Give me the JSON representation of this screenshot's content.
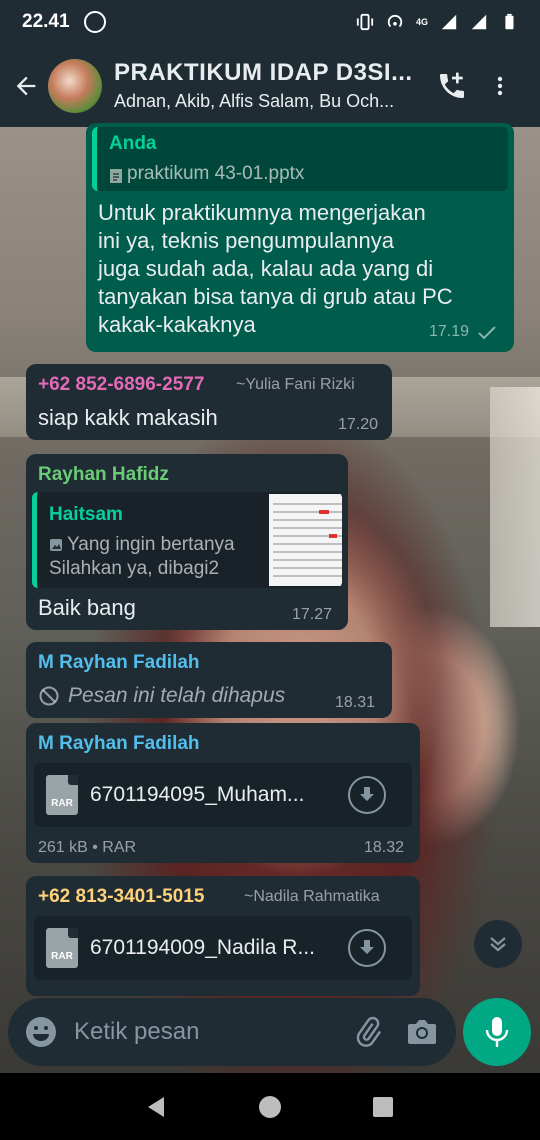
{
  "status_bar": {
    "time": "22.41",
    "network": "4G"
  },
  "header": {
    "group_name": "PRAKTIKUM IDAP D3SI...",
    "members": "Adnan, Akib, Alfis Salam, Bu Och..."
  },
  "messages": {
    "m1": {
      "quote_author": "Anda",
      "quote_file": "praktikum 43-01.pptx",
      "text_lines": [
        "Untuk praktikumnya mengerjakan",
        "ini ya, teknis pengumpulannya",
        "juga sudah ada, kalau ada yang di",
        "tanyakan bisa tanya di grub atau PC",
        "kakak-kakaknya"
      ],
      "time": "17.19"
    },
    "m2": {
      "sender": "+62 852-6896-2577",
      "pushname": "~Yulia Fani Rizki",
      "text": "siap kakk makasih",
      "time": "17.20"
    },
    "m3": {
      "sender": "Rayhan Hafidz",
      "quote_author": "Haitsam",
      "quote_line1": "Yang ingin bertanya",
      "quote_line2": "Silahkan ya, dibagi2",
      "text": "Baik bang",
      "time": "17.27"
    },
    "m4": {
      "sender": "M Rayhan Fadilah",
      "text": "Pesan ini telah dihapus",
      "time": "18.31"
    },
    "m5": {
      "sender": "M Rayhan Fadilah",
      "file_name": "6701194095_Muham...",
      "file_type": "RAR",
      "file_info": "261 kB • RAR",
      "time": "18.32"
    },
    "m6": {
      "sender": "+62 813-3401-5015",
      "pushname": "~Nadila Rahmatika",
      "file_name": "6701194009_Nadila R...",
      "file_type": "RAR"
    }
  },
  "compose": {
    "placeholder": "Ketik pesan"
  },
  "colors": {
    "header_bg": "#1f2c34",
    "incoming_bubble": "#1f2c34",
    "outgoing_bubble": "#005c4b",
    "accent": "#00a884",
    "sender_pink": "#e26ab6",
    "sender_green": "#6bcb77",
    "sender_blue": "#53bdeb",
    "sender_yellow": "#ffd279"
  }
}
